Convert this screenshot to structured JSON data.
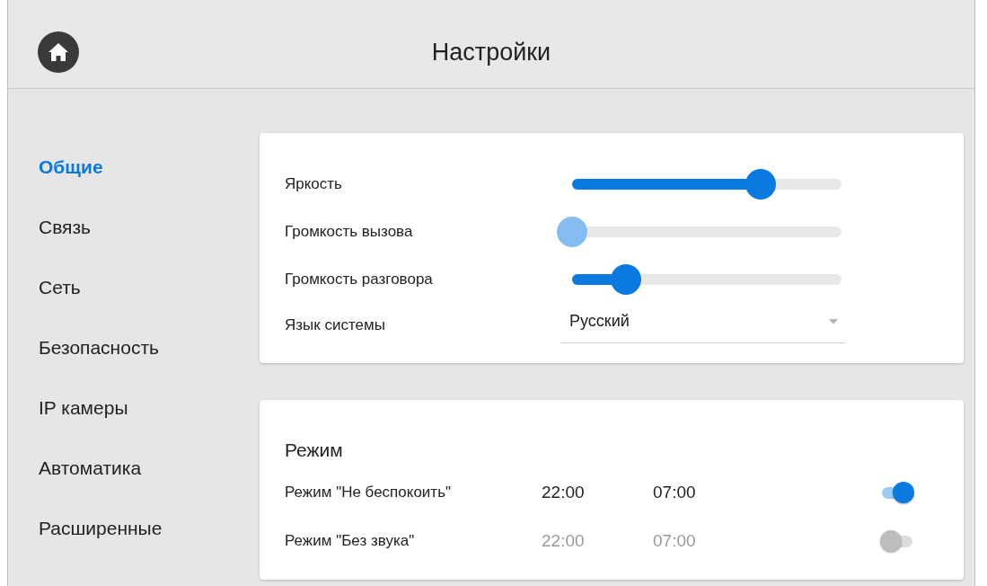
{
  "header": {
    "title": "Настройки"
  },
  "sidebar": {
    "items": [
      {
        "label": "Общие",
        "selected": true
      },
      {
        "label": "Связь",
        "selected": false
      },
      {
        "label": "Сеть",
        "selected": false
      },
      {
        "label": "Безопасность",
        "selected": false
      },
      {
        "label": "IP камеры",
        "selected": false
      },
      {
        "label": "Автоматика",
        "selected": false
      },
      {
        "label": "Расширенные",
        "selected": false
      }
    ]
  },
  "system": {
    "sliders": [
      {
        "label": "Яркость",
        "level": 0.7,
        "disabled": false
      },
      {
        "label": "Громкость вызова",
        "level": 0,
        "disabled": true
      },
      {
        "label": "Громкость разговора",
        "level": 0.2,
        "disabled": false
      }
    ],
    "language": {
      "label": "Язык системы",
      "value": "Русский"
    }
  },
  "mode": {
    "title": "Режим",
    "rows": [
      {
        "label": "Режим \"Не беспокоить\"",
        "start": "22:00",
        "end": "07:00",
        "on": true
      },
      {
        "label": "Режим \"Без звука\"",
        "start": "22:00",
        "end": "07:00",
        "on": false
      }
    ]
  }
}
